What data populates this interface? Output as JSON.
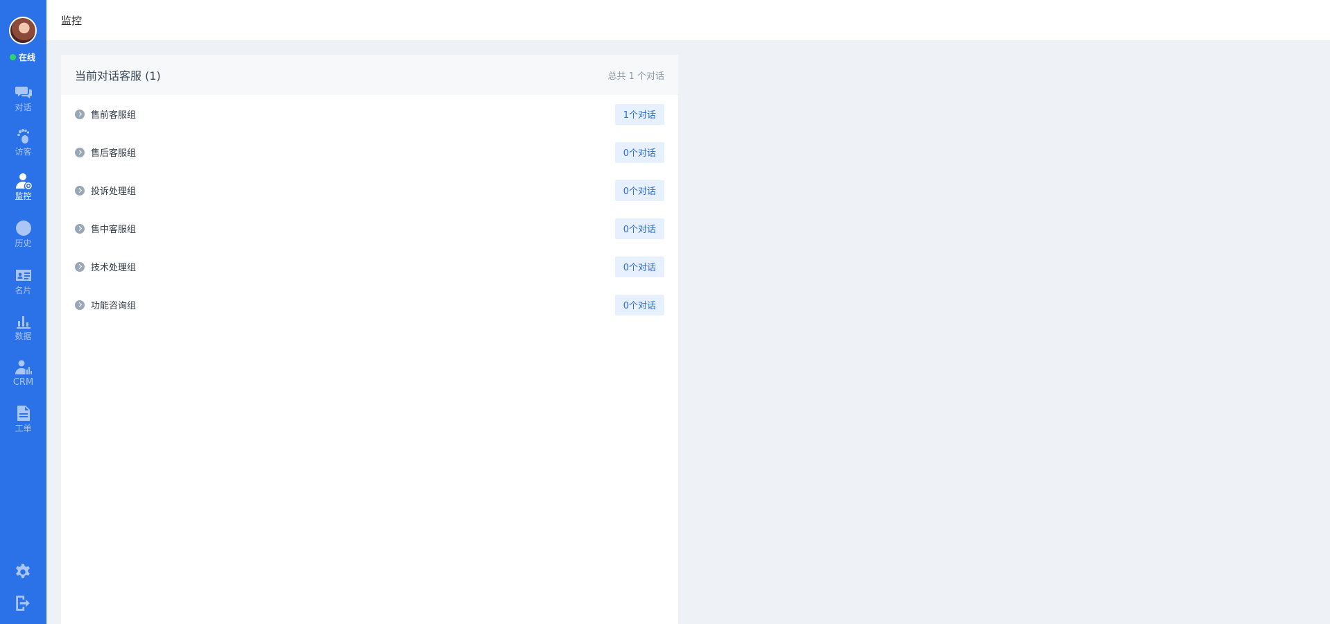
{
  "sidebar": {
    "status": "在线",
    "nav": [
      {
        "label": "对话",
        "icon": "chat-icon"
      },
      {
        "label": "访客",
        "icon": "footprint-icon"
      },
      {
        "label": "监控",
        "icon": "monitor-user-icon"
      },
      {
        "label": "历史",
        "icon": "clock-icon"
      },
      {
        "label": "名片",
        "icon": "id-card-icon"
      },
      {
        "label": "数据",
        "icon": "bar-chart-icon"
      },
      {
        "label": "CRM",
        "icon": "crm-user-chart-icon"
      },
      {
        "label": "工单",
        "icon": "document-icon"
      }
    ],
    "active": "监控",
    "bottom": [
      {
        "icon": "gear-icon"
      },
      {
        "icon": "logout-icon"
      }
    ]
  },
  "header": {
    "title": "监控"
  },
  "panel": {
    "title": "当前对话客服 (1)",
    "total": "总共 1 个对话",
    "groups": [
      {
        "name": "售前客服组",
        "count": "1个对话"
      },
      {
        "name": "售后客服组",
        "count": "0个对话"
      },
      {
        "name": "投诉处理组",
        "count": "0个对话"
      },
      {
        "name": "售中客服组",
        "count": "0个对话"
      },
      {
        "name": "技术处理组",
        "count": "0个对话"
      },
      {
        "name": "功能咨询组",
        "count": "0个对话"
      }
    ]
  },
  "colors": {
    "sidebar": "#2b72e8",
    "online": "#2fd36b",
    "badge_bg": "#e7f0fe",
    "badge_text": "#2b6ad8"
  }
}
